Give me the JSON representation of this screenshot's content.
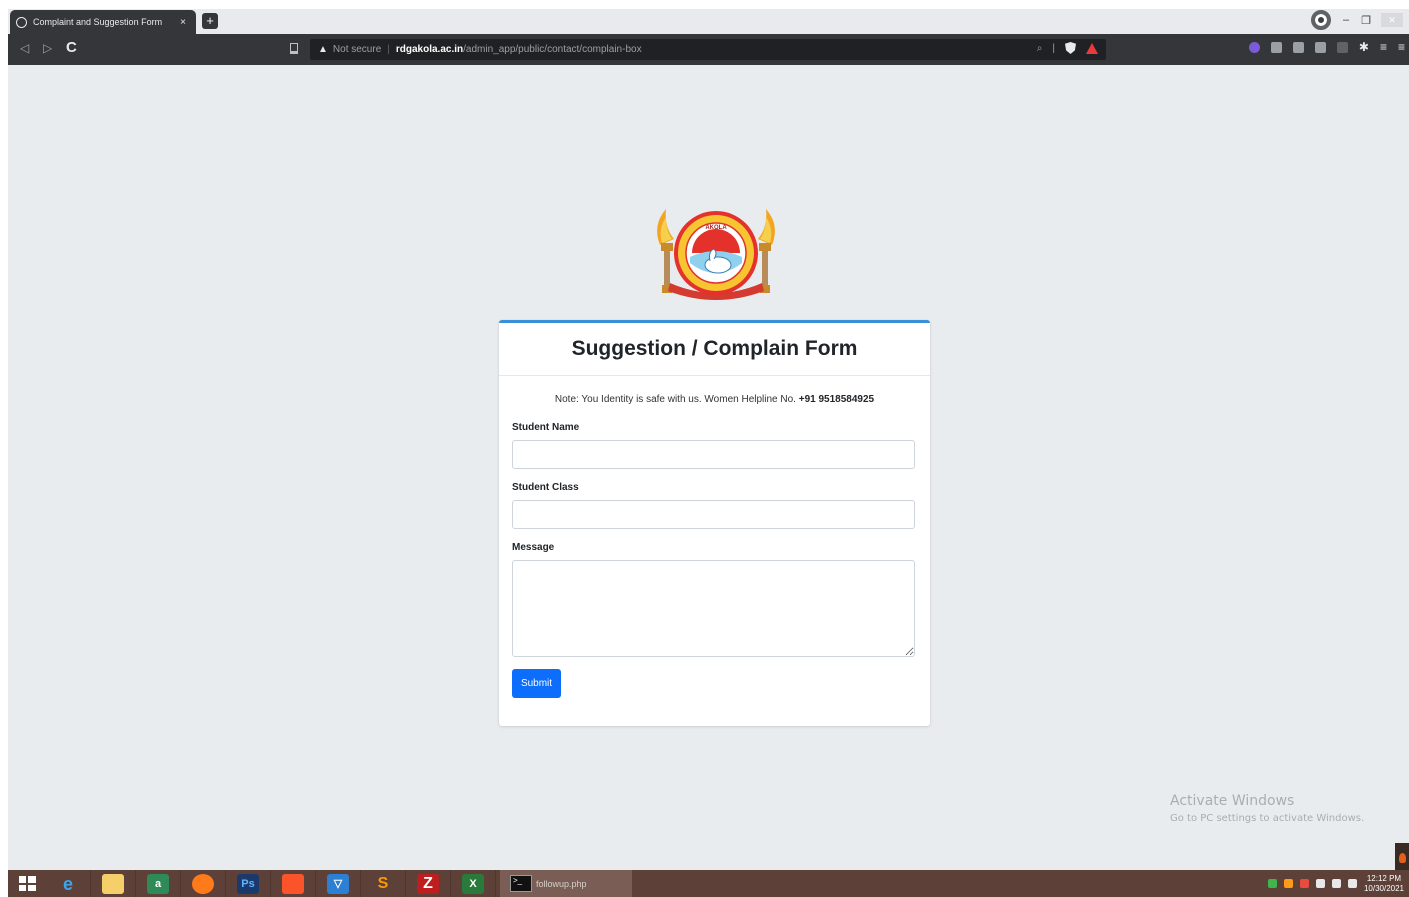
{
  "browser": {
    "tab_title": "Complaint and Suggestion Form",
    "tab_close": "×",
    "new_tab": "+",
    "security_label": "Not secure",
    "url_host": "rdgakola.ac.in",
    "url_path": "/admin_app/public/contact/complain-box"
  },
  "form": {
    "title": "Suggestion / Complain Form",
    "note_prefix": "Note: You Identity is safe with us. Women Helpline No.",
    "helpline": "+91 9518584925",
    "fields": [
      {
        "label": "Student Name",
        "value": "",
        "placeholder": ""
      },
      {
        "label": "Student Class",
        "value": "",
        "placeholder": ""
      },
      {
        "label": "Message",
        "value": "",
        "placeholder": ""
      }
    ],
    "submit_label": "Submit"
  },
  "logo": {
    "text_top": "AKOLA"
  },
  "watermark": {
    "title": "Activate Windows",
    "subtitle": "Go to PC settings to activate Windows."
  },
  "taskbar": {
    "window_label": "followup.php",
    "clock_time": "12:12 PM",
    "clock_date": "10/30/2021"
  },
  "colors": {
    "accent": "#0d6efd",
    "card_border": "#3a8fd8",
    "page_bg": "#e9ecef",
    "taskbar": "#5d4038"
  }
}
